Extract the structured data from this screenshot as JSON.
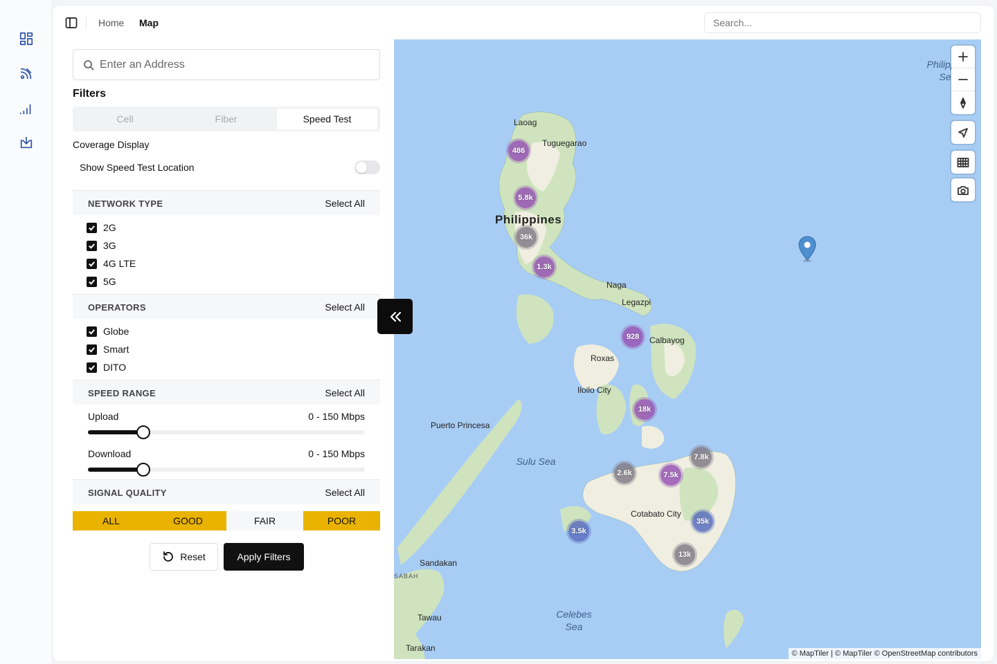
{
  "sidebar_icons": [
    "dashboard-icon",
    "satellite-icon",
    "signal-icon",
    "download-icon"
  ],
  "header": {
    "breadcrumb": [
      "Home",
      "Map"
    ],
    "search_placeholder": "Search..."
  },
  "filters": {
    "address_placeholder": "Enter an Address",
    "title": "Filters",
    "tabs": [
      {
        "label": "Cell",
        "active": false
      },
      {
        "label": "Fiber",
        "active": false
      },
      {
        "label": "Speed Test",
        "active": true
      }
    ],
    "coverage_display": "Coverage Display",
    "show_location_label": "Show Speed Test Location",
    "show_location_on": false,
    "select_all": "Select All",
    "network_type": {
      "title": "NETWORK TYPE",
      "options": [
        {
          "label": "2G",
          "checked": true
        },
        {
          "label": "3G",
          "checked": true
        },
        {
          "label": "4G LTE",
          "checked": true
        },
        {
          "label": "5G",
          "checked": true
        }
      ]
    },
    "operators": {
      "title": "OPERATORS",
      "options": [
        {
          "label": "Globe",
          "checked": true
        },
        {
          "label": "Smart",
          "checked": true
        },
        {
          "label": "DITO",
          "checked": true
        }
      ]
    },
    "speed_range": {
      "title": "SPEED RANGE",
      "upload": {
        "label": "Upload",
        "value": "0 - 150 Mbps",
        "level": 0.2
      },
      "download": {
        "label": "Download",
        "value": "0 - 150 Mbps",
        "level": 0.2
      }
    },
    "signal_quality": {
      "title": "SIGNAL QUALITY",
      "options": [
        {
          "label": "ALL",
          "selected": true
        },
        {
          "label": "GOOD",
          "selected": true
        },
        {
          "label": "FAIR",
          "selected": false
        },
        {
          "label": "POOR",
          "selected": true
        }
      ],
      "selected_color": "#e9b300"
    },
    "reset_label": "Reset",
    "apply_label": "Apply Filters"
  },
  "map": {
    "country": "Philippines",
    "seas": [
      {
        "name": "Philippine Sea"
      },
      {
        "name": "Sulu Sea"
      },
      {
        "name": "Celebes Sea"
      }
    ],
    "places": [
      "Laoag",
      "Tuguegarao",
      "Naga",
      "Legazpi",
      "Calbayog",
      "Roxas",
      "Iloilo City",
      "Puerto Princesa",
      "Cotabato City",
      "Sandakan",
      "SABAH",
      "Tawau",
      "Tarakan"
    ],
    "clusters": [
      "486",
      "5.8k",
      "36k",
      "1.3k",
      "928",
      "18k",
      "2.6k",
      "7.5k",
      "7.8k",
      "35k",
      "3.5k",
      "13k"
    ],
    "attribution": "© MapTiler | © MapTiler © OpenStreetMap contributors",
    "colors": {
      "water": "#a8cdf4",
      "land": "#efeee0",
      "green": "#cfe4be"
    }
  }
}
